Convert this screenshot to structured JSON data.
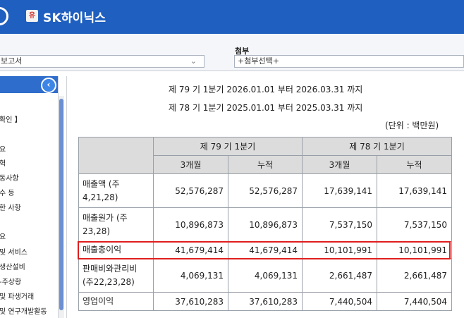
{
  "titlebar": {
    "logo_text": "유",
    "company": "SK하이닉스"
  },
  "controls": {
    "report_value": "보고서",
    "attach_label": "첨부",
    "attach_value": "+첨부선택+"
  },
  "sidebar": {
    "items": [
      "확인 】",
      "요",
      "혁",
      "동사항",
      "수 등",
      "한 사항",
      "요",
      "및 서비스",
      "생산설비",
      "-주상황",
      "및 파생거래",
      "및 연구개발활동"
    ]
  },
  "document": {
    "period_current": "제 79 기 1분기 2026.01.01 부터 2026.03.31 까지",
    "period_prior": "제 78 기 1분기 2025.01.01 부터 2025.03.31 까지",
    "unit": "(단위 : 백만원)",
    "table": {
      "group_headers": [
        "제 79 기 1분기",
        "제 78 기 1분기"
      ],
      "sub_headers": [
        "3개월",
        "누적",
        "3개월",
        "누적"
      ],
      "rows": [
        {
          "label": "매출액 (주4,21,28)",
          "values": [
            "52,576,287",
            "52,576,287",
            "17,639,141",
            "17,639,141"
          ]
        },
        {
          "label": "매출원가 (주23,28)",
          "values": [
            "10,896,873",
            "10,896,873",
            "7,537,150",
            "7,537,150"
          ]
        },
        {
          "label": "매출총이익",
          "values": [
            "41,679,414",
            "41,679,414",
            "10,101,991",
            "10,101,991"
          ]
        },
        {
          "label": "판매비와관리비 (주22,23,28)",
          "values": [
            "4,069,131",
            "4,069,131",
            "2,661,487",
            "2,661,487"
          ]
        },
        {
          "label": "영업이익",
          "values": [
            "37,610,283",
            "37,610,283",
            "7,440,504",
            "7,440,504"
          ]
        }
      ]
    }
  }
}
